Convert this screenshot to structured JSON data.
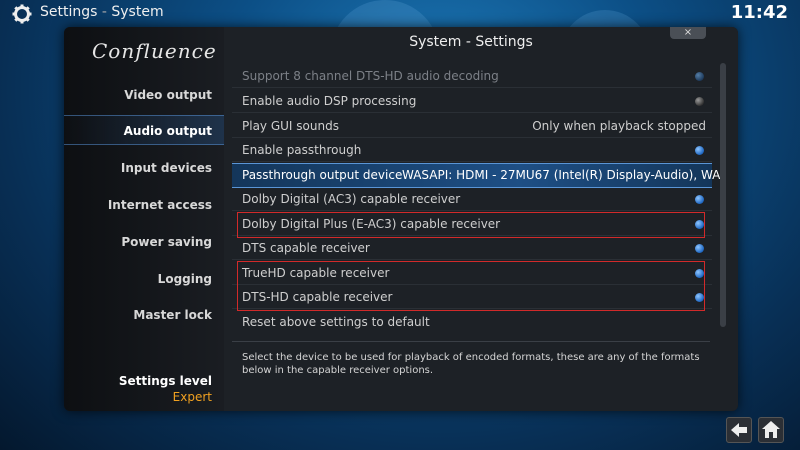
{
  "topbar": {
    "section": "Settings",
    "separator": " - ",
    "subsection": "System",
    "clock": "11:42"
  },
  "sidebar": {
    "logo": "Confluence",
    "items": [
      {
        "label": "Video output"
      },
      {
        "label": "Audio output"
      },
      {
        "label": "Input devices"
      },
      {
        "label": "Internet access"
      },
      {
        "label": "Power saving"
      },
      {
        "label": "Logging"
      },
      {
        "label": "Master lock"
      }
    ],
    "active_index": 1,
    "level_label": "Settings level",
    "level_value": "Expert"
  },
  "content": {
    "title": "System - Settings",
    "close_label": "×",
    "rows": [
      {
        "label": "Support 8 channel DTS-HD audio decoding",
        "state": "dim-on"
      },
      {
        "label": "Enable audio DSP processing",
        "state": "off"
      },
      {
        "label": "Play GUI sounds",
        "value": "Only when playback stopped"
      },
      {
        "label": "Enable passthrough",
        "state": "on"
      },
      {
        "label": "Passthrough output device",
        "value": "WASAPI: HDMI - 27MU67 (Intel(R) Display-Audio), WA"
      },
      {
        "label": "Dolby Digital (AC3) capable receiver",
        "state": "on"
      },
      {
        "label": "Dolby Digital Plus (E-AC3) capable receiver",
        "state": "on"
      },
      {
        "label": "DTS capable receiver",
        "state": "on"
      },
      {
        "label": "TrueHD capable receiver",
        "state": "on"
      },
      {
        "label": "DTS-HD capable receiver",
        "state": "on"
      },
      {
        "label": "Reset above settings to default"
      }
    ],
    "description": "Select the device to be used for playback of encoded formats, these are any of the formats below in the capable receiver options."
  },
  "colors": {
    "highlight_box": "#d12a2a",
    "accent_level": "#f0a020",
    "focus_bg": "#1e4f85"
  }
}
